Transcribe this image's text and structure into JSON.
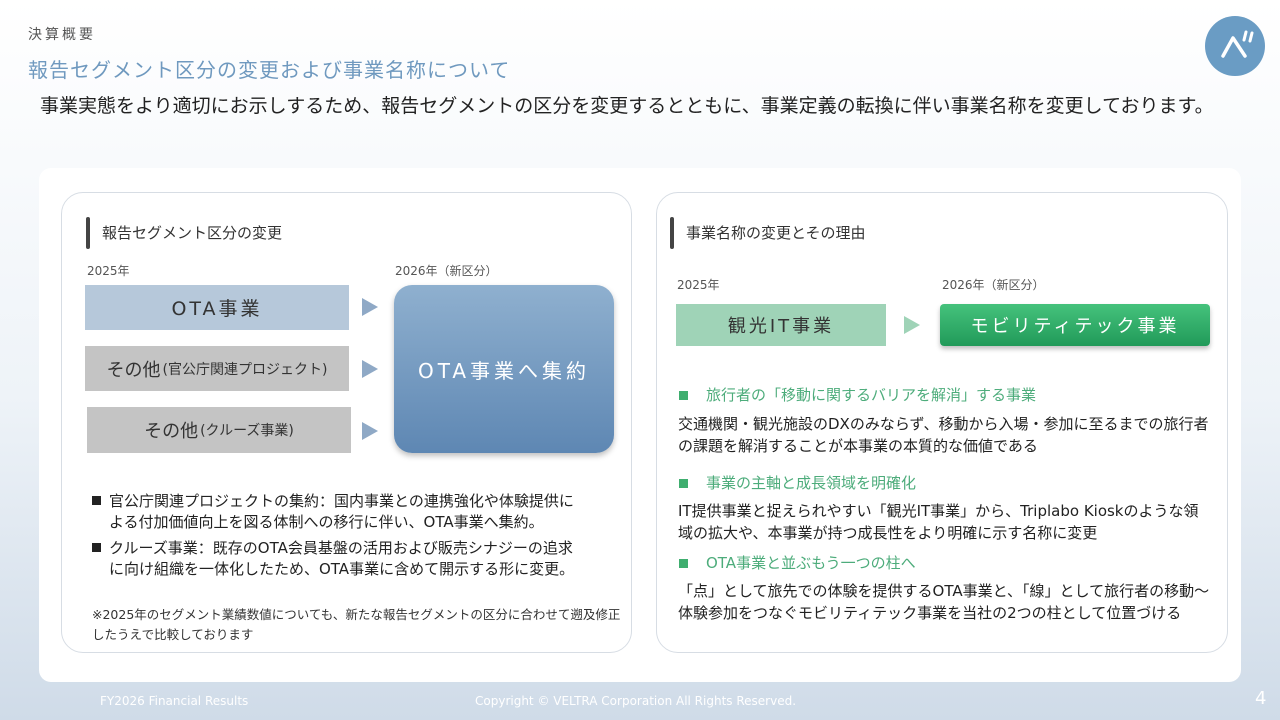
{
  "header": {
    "section": "決算概要",
    "title": "報告セグメント区分の変更および事業名称について",
    "lead": "事業実態をより適切にお示しするため、報告セグメントの区分を変更するとともに、事業定義の転換に伴い事業名称を変更しております。"
  },
  "logo": {
    "mark": "ベ",
    "color": "#6a9cc4"
  },
  "left_panel": {
    "heading": "報告セグメント区分の変更",
    "year_before": "2025年",
    "year_after": "2026年（新区分）",
    "segments": [
      {
        "main": "OTA事業",
        "note": ""
      },
      {
        "main": "その他",
        "note": "(官公庁関連プロジェクト)"
      },
      {
        "main": "その他",
        "note": "(クルーズ事業)"
      }
    ],
    "merged": "OTA事業へ集約",
    "bullets": [
      {
        "line1": "官公庁関連プロジェクトの集約：国内事業との連携強化や体験提供に",
        "line2": "よる付加価値向上を図る体制への移行に伴い、OTA事業へ集約。"
      },
      {
        "line1": "クルーズ事業：既存のOTA会員基盤の活用および販売シナジーの追求",
        "line2": "に向け組織を一体化したため、OTA事業に含めて開示する形に変更。"
      }
    ],
    "footnote": "※2025年のセグメント業績数値についても、新たな報告セグメントの区分に合わせて遡及修正したうえで比較しております"
  },
  "right_panel": {
    "heading": "事業名称の変更とその理由",
    "year_before": "2025年",
    "year_after": "2026年（新区分）",
    "old_name": "観光IT事業",
    "new_name": "モビリティテック事業",
    "reasons": [
      {
        "title": "旅行者の「移動に関するバリアを解消」する事業",
        "text": "交通機関・観光施設のDXのみならず、移動から入場・参加に至るまでの旅行者の課題を解消することが本事業の本質的な価値である"
      },
      {
        "title": "事業の主軸と成長領域を明確化",
        "text": "IT提供事業と捉えられやすい「観光IT事業」から、Triplabo Kioskのような領域の拡大や、本事業が持つ成長性をより明確に示す名称に変更"
      },
      {
        "title": "OTA事業と並ぶもう一つの柱へ",
        "text": "「点」として旅先での体験を提供するOTA事業と、「線」として旅行者の移動〜体験参加をつなぐモビリティテック事業を当社の2つの柱として位置づける"
      }
    ]
  },
  "footer": {
    "left": "FY2026 Financial Results",
    "center": "Copyright © VELTRA Corporation All Rights Reserved.",
    "page": "4"
  }
}
